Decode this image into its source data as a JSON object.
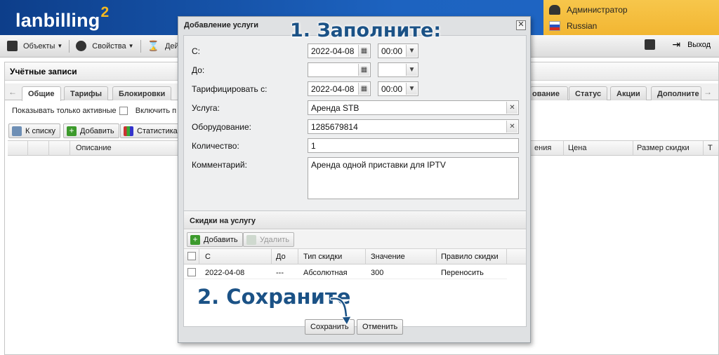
{
  "header": {
    "logo": "lanbilling",
    "logo_sup": "2",
    "user_name": "Администратор",
    "language": "Russian"
  },
  "toolbar": {
    "objects": "Объекты",
    "properties": "Свойства",
    "actions": "Дейс",
    "logout": "Выход"
  },
  "accounts": {
    "title": "Учётные записи",
    "tabs": [
      "Общие",
      "Тарифы",
      "Блокировки",
      "ование",
      "Статус",
      "Акции",
      "Дополните"
    ],
    "filter_active": "Показывать только активные",
    "filter_include": "Включить п",
    "btn_list": "К списку",
    "btn_add": "Добавить",
    "btn_stats": "Статистика",
    "columns": [
      "Описание",
      "ения",
      "Цена",
      "Размер скидки",
      "Т"
    ]
  },
  "dialog": {
    "title": "Добавление услуги",
    "fields": {
      "from_label": "С:",
      "from_date": "2022-04-08",
      "from_time": "00:00",
      "to_label": "До:",
      "to_date": "",
      "to_time": "",
      "charge_label": "Тарифицировать с:",
      "charge_date": "2022-04-08",
      "charge_time": "00:00",
      "service_label": "Услуга:",
      "service_value": "Аренда STB",
      "equipment_label": "Оборудование:",
      "equipment_value": "1285679814",
      "quantity_label": "Количество:",
      "quantity_value": "1",
      "comment_label": "Комментарий:",
      "comment_value": "Аренда одной приставки для IPTV"
    },
    "discounts": {
      "title": "Скидки на услугу",
      "add": "Добавить",
      "delete": "Удалить",
      "columns": [
        "С",
        "До",
        "Тип скидки",
        "Значение",
        "Правило скидки"
      ],
      "rows": [
        {
          "from": "2022-04-08",
          "to": "---",
          "type": "Абсолютная",
          "value": "300",
          "rule": "Переносить"
        }
      ]
    },
    "save": "Сохранить",
    "cancel": "Отменить"
  },
  "annotations": {
    "step1": "1. Заполните:",
    "step2": "2. Сохраните"
  }
}
